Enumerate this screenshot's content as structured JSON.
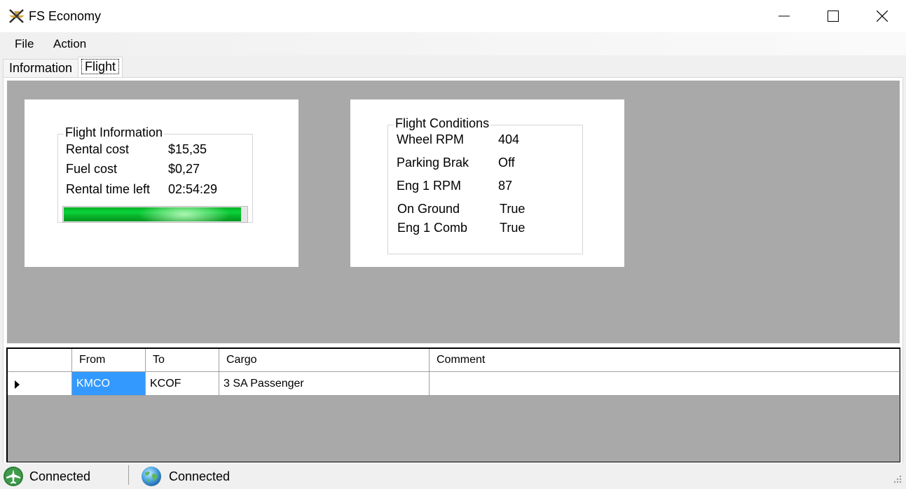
{
  "window": {
    "title": "FS Economy",
    "icon": "fs-economy-plane-logo-icon"
  },
  "menu": {
    "items": [
      "File",
      "Action"
    ]
  },
  "tabs": [
    {
      "label": "Information",
      "selected": false
    },
    {
      "label": "Flight",
      "selected": true
    }
  ],
  "flight_information": {
    "title": "Flight Information",
    "rows": [
      {
        "label": "Rental cost",
        "value": "$15,35"
      },
      {
        "label": "Fuel cost",
        "value": "$0,27"
      },
      {
        "label": "Rental time left",
        "value": "02:54:29"
      }
    ],
    "rental_progress_percent": 97
  },
  "flight_conditions": {
    "title": "Flight Conditions",
    "rows": [
      {
        "label": "Wheel RPM",
        "value": "404"
      },
      {
        "label": "Parking Brak",
        "value": "Off"
      },
      {
        "label": "Eng 1 RPM",
        "value": "87"
      },
      {
        "label": "On Ground",
        "value": "True"
      },
      {
        "label": "Eng 1 Comb",
        "value": "True"
      }
    ]
  },
  "grid": {
    "columns": [
      "From",
      "To",
      "Cargo",
      "Comment"
    ],
    "rows": [
      {
        "from": "KMCO",
        "to": "KCOF",
        "cargo": "3 SA Passenger",
        "comment": ""
      }
    ]
  },
  "status": {
    "items": [
      {
        "icon": "airplane-icon",
        "text": "Connected"
      },
      {
        "icon": "globe-icon",
        "text": "Connected"
      }
    ]
  },
  "colors": {
    "selection": "#3399ff",
    "panel_gray": "#a9a9a9",
    "progress_green": "#06b025"
  }
}
